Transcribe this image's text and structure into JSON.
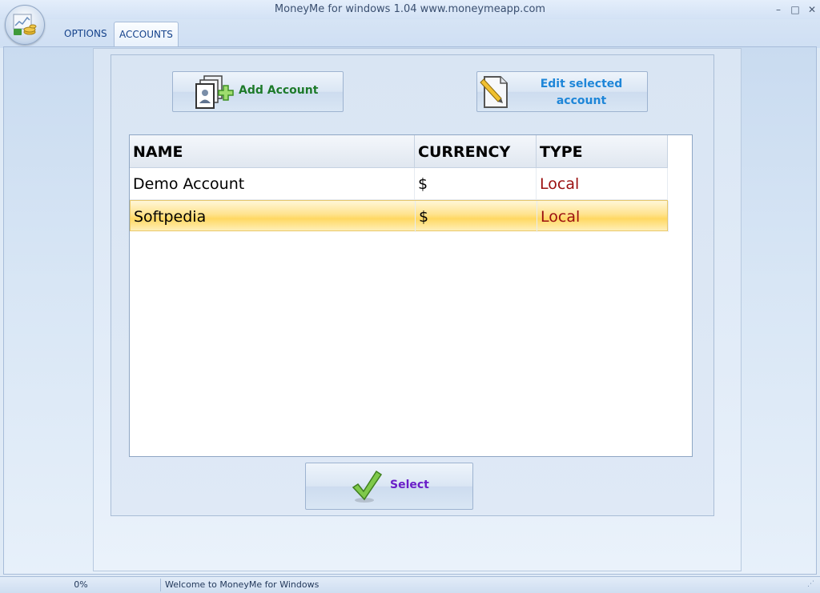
{
  "window": {
    "title": "MoneyMe for windows 1.04 www.moneymeapp.com",
    "controls": {
      "minimize": "–",
      "maximize": "□",
      "close": "✕"
    }
  },
  "app_orb_icon": "money-chart-icon",
  "tabs": [
    {
      "label": "OPTIONS",
      "active": false
    },
    {
      "label": "ACCOUNTS",
      "active": true
    }
  ],
  "toolbar": {
    "add_label": "Add Account",
    "edit_label_line1": "Edit selected",
    "edit_label_line2": "account",
    "select_label": "Select"
  },
  "grid": {
    "columns": [
      "NAME",
      "CURRENCY",
      "TYPE"
    ],
    "rows": [
      {
        "name": "Demo Account",
        "currency": "$",
        "type": "Local",
        "selected": false
      },
      {
        "name": "Softpedia",
        "currency": "$",
        "type": "Local",
        "selected": true
      }
    ]
  },
  "status": {
    "progress": "0%",
    "message": "Welcome to MoneyMe for Windows"
  },
  "colors": {
    "accent": "#15428b",
    "add_text": "#1d7a2a",
    "edit_text": "#1e86d8",
    "select_text": "#6a1ec8",
    "type_text": "#9b1010",
    "selected_row": "#ffd862"
  }
}
